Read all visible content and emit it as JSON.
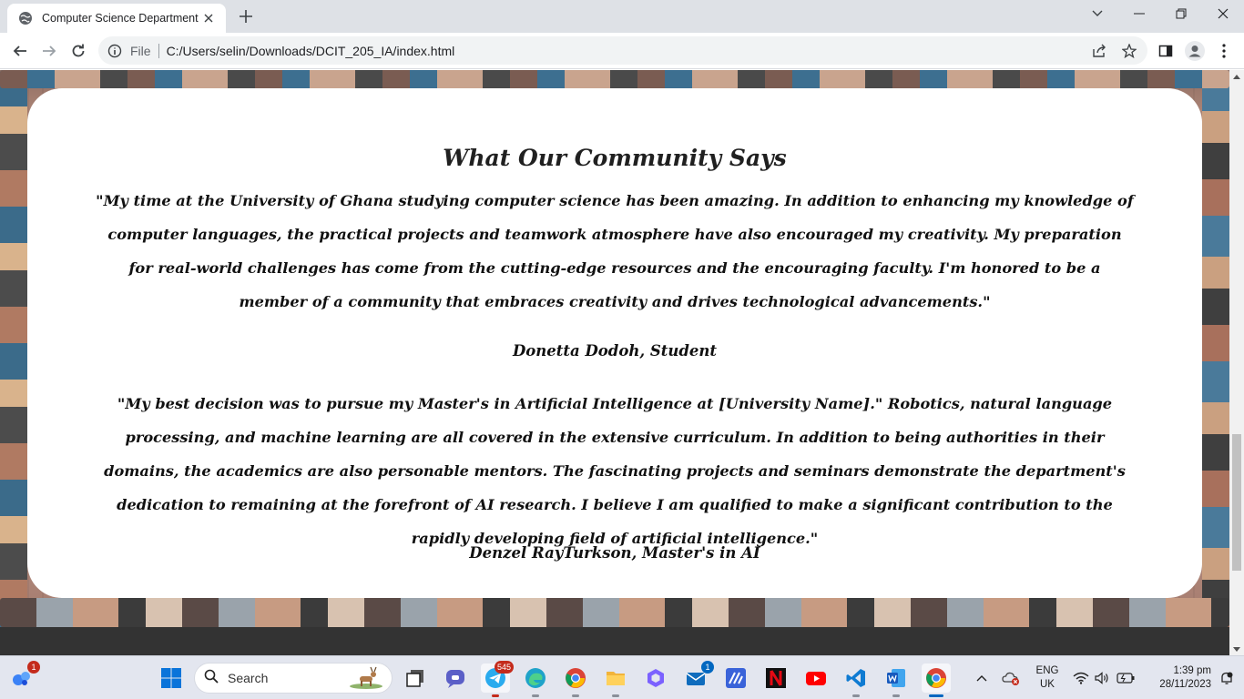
{
  "browser": {
    "tab_title": "Computer Science Department",
    "url_scheme": "File",
    "url": "C:/Users/selin/Downloads/DCIT_205_IA/index.html"
  },
  "testimonials": {
    "heading": "What Our Community Says",
    "items": [
      {
        "quote": "\"My time at the University of Ghana studying computer science has been amazing. In addition to enhancing my knowledge of computer languages, the practical projects and teamwork atmosphere have also encouraged my creativity. My preparation for real-world challenges has come from the cutting-edge resources and the encouraging faculty. I'm honored to be a member of a community that embraces creativity and drives technological advancements.\"",
        "author": "Donetta Dodoh, Student"
      },
      {
        "quote": "\"My best decision was to pursue my Master's in Artificial Intelligence at [University Name].\" Robotics, natural language processing, and machine learning are all covered in the extensive curriculum. In addition to being authorities in their domains, the academics are also personable mentors. The fascinating projects and seminars demonstrate the department's dedication to remaining at the forefront of AI research. I believe I am qualified to make a significant contribution to the rapidly developing field of artificial intelligence.\"",
        "author": "Denzel RayTurkson, Master's in AI"
      }
    ]
  },
  "taskbar": {
    "widgets_badge": "1",
    "search_label": "Search",
    "telegram_badge": "545",
    "mail_badge": "1",
    "language": "ENG",
    "region": "UK",
    "time": "1:39 pm",
    "date": "28/11/2023"
  },
  "colors": {
    "card": "#ffffff",
    "footer": "#333333",
    "text": "#111111"
  }
}
